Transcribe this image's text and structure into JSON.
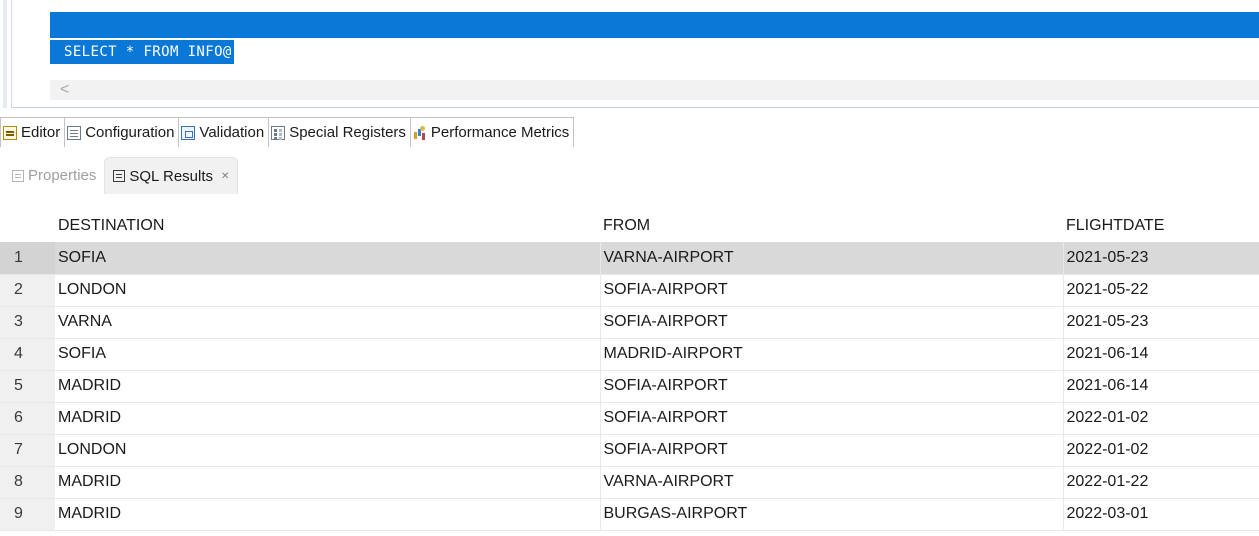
{
  "editor": {
    "code": "SELECT * FROM INFO@",
    "scroll_left_glyph": "<"
  },
  "editor_tabs": [
    {
      "label": "Editor",
      "icon": "sql-editor-icon"
    },
    {
      "label": "Configuration",
      "icon": "configuration-icon"
    },
    {
      "label": "Validation",
      "icon": "validation-icon"
    },
    {
      "label": "Special Registers",
      "icon": "special-registers-icon"
    },
    {
      "label": "Performance Metrics",
      "icon": "performance-metrics-icon"
    }
  ],
  "result_tabs": {
    "properties": {
      "label": "Properties",
      "icon": "properties-icon",
      "active": false
    },
    "sql_results": {
      "label": "SQL Results",
      "icon": "sql-results-icon",
      "active": true,
      "close_glyph": "✕"
    }
  },
  "results": {
    "columns": [
      "DESTINATION",
      "FROM",
      "FLIGHTDATE"
    ],
    "selected_row": 1,
    "rows": [
      {
        "num": "1",
        "destination": "SOFIA",
        "from": "VARNA-AIRPORT",
        "flightdate": "2021-05-23"
      },
      {
        "num": "2",
        "destination": "LONDON",
        "from": "SOFIA-AIRPORT",
        "flightdate": "2021-05-22"
      },
      {
        "num": "3",
        "destination": "VARNA",
        "from": "SOFIA-AIRPORT",
        "flightdate": "2021-05-23"
      },
      {
        "num": "4",
        "destination": "SOFIA",
        "from": "MADRID-AIRPORT",
        "flightdate": "2021-06-14"
      },
      {
        "num": "5",
        "destination": "MADRID",
        "from": "SOFIA-AIRPORT",
        "flightdate": "2021-06-14"
      },
      {
        "num": "6",
        "destination": "MADRID",
        "from": "SOFIA-AIRPORT",
        "flightdate": "2022-01-02"
      },
      {
        "num": "7",
        "destination": "LONDON",
        "from": "SOFIA-AIRPORT",
        "flightdate": "2022-01-02"
      },
      {
        "num": "8",
        "destination": "MADRID",
        "from": "VARNA-AIRPORT",
        "flightdate": "2022-01-22"
      },
      {
        "num": "9",
        "destination": "MADRID",
        "from": "BURGAS-AIRPORT",
        "flightdate": "2022-03-01"
      }
    ]
  }
}
